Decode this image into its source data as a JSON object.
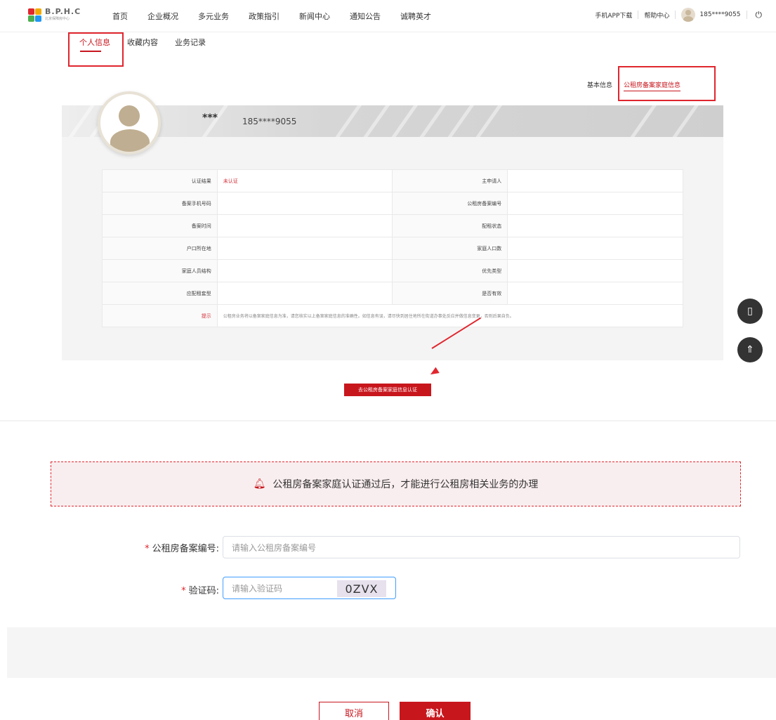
{
  "header": {
    "logo_text": "B.P.H.C",
    "logo_sub": "北京保障房中心",
    "menu": [
      "首页",
      "企业概况",
      "多元业务",
      "政策指引",
      "新闻中心",
      "通知公告",
      "诚聘英才"
    ],
    "app_download": "手机APP下载",
    "help_center": "帮助中心",
    "user_phone": "185****9055"
  },
  "subtabs": [
    "个人信息",
    "收藏内容",
    "业务记录"
  ],
  "righttabs": [
    "基本信息",
    "公租房备案家庭信息"
  ],
  "profile": {
    "name": "***",
    "phone": "185****9055"
  },
  "info_table": {
    "rows": [
      {
        "l1": "认证结果",
        "v1": "未认证",
        "l2": "主申请人",
        "v2": ""
      },
      {
        "l1": "备案手机号码",
        "v1": "",
        "l2": "公租房备案编号",
        "v2": ""
      },
      {
        "l1": "备案时间",
        "v1": "",
        "l2": "配租状态",
        "v2": ""
      },
      {
        "l1": "户口所在地",
        "v1": "",
        "l2": "家庭人口数",
        "v2": ""
      },
      {
        "l1": "家庭人员结构",
        "v1": "",
        "l2": "优先类型",
        "v2": ""
      },
      {
        "l1": "应配租套型",
        "v1": "",
        "l2": "是否有效",
        "v2": ""
      }
    ],
    "tip_label": "提示",
    "tip_text": "公租房业务将以备案家庭信息为准，请您核实以上备案家庭信息的准确性。如信息有误，请尽快到居住地所在街道办事处反应并做信息变更，否则后果自负。"
  },
  "verify_button": "去公租房备案家庭信息认证",
  "notice": "公租房备案家庭认证通过后，才能进行公租房相关业务的办理",
  "form": {
    "record_label": "公租房备案编号:",
    "record_placeholder": "请输入公租房备案编号",
    "captcha_label": "验证码:",
    "captcha_placeholder": "请输入验证码",
    "captcha_code": "0ZVX",
    "required_mark": "*"
  },
  "buttons": {
    "cancel": "取消",
    "confirm": "确认"
  },
  "colors": {
    "brand_red": "#c8161d",
    "annotation_red": "#e0262e"
  }
}
